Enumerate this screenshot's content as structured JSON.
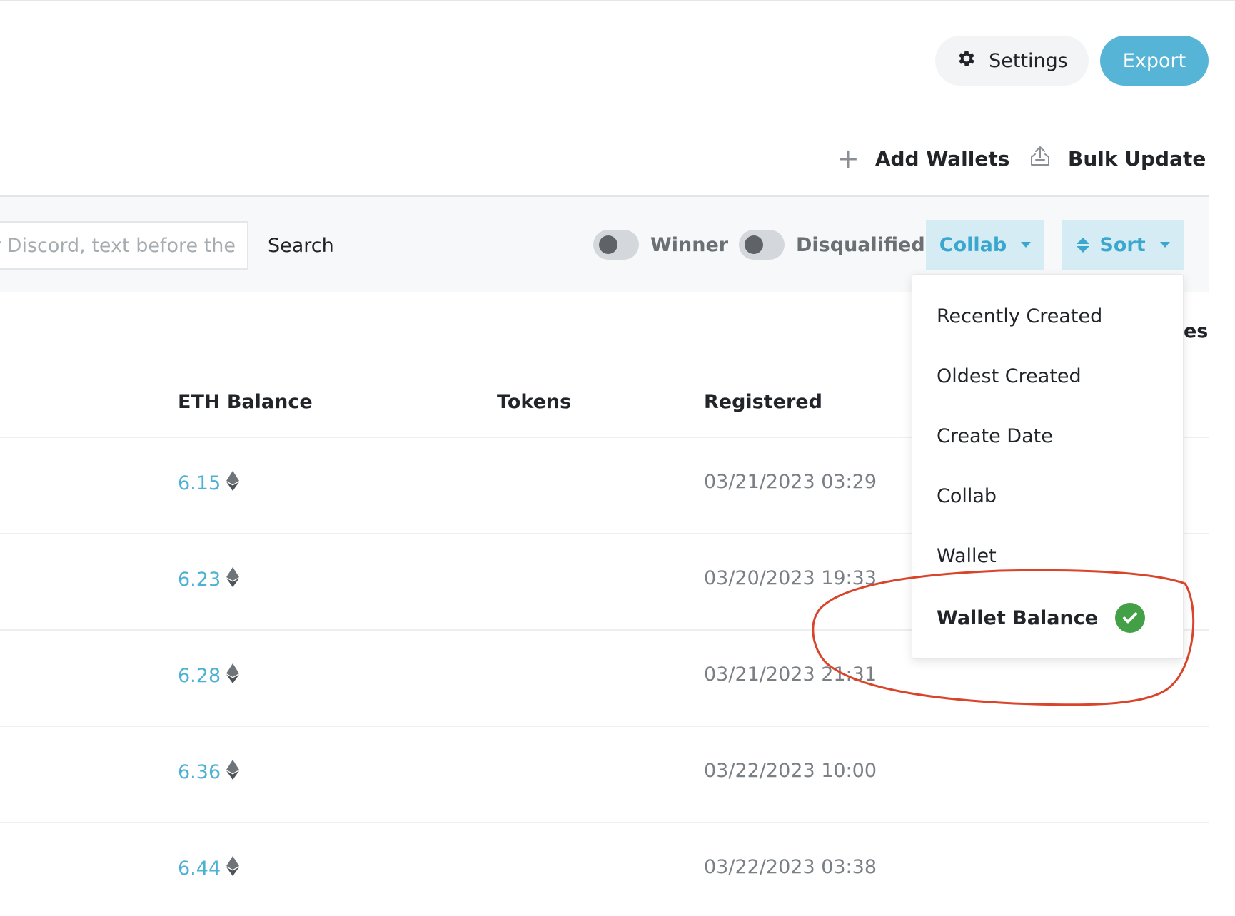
{
  "header": {
    "settings_label": "Settings",
    "export_label": "Export"
  },
  "actions": {
    "add_wallets": "Add Wallets",
    "bulk_update": "Bulk Update"
  },
  "filters": {
    "search_placeholder": "r Discord, text before the #",
    "search_button": "Search",
    "winner_label": "Winner",
    "disqualified_label": "Disqualified",
    "collab_label": "Collab",
    "sort_label": "Sort"
  },
  "table": {
    "partial_header": "es",
    "columns": [
      "ETH Balance",
      "Tokens",
      "Registered"
    ],
    "rows": [
      {
        "eth": "6.15",
        "tokens": "",
        "registered": "03/21/2023 03:29"
      },
      {
        "eth": "6.23",
        "tokens": "",
        "registered": "03/20/2023 19:33"
      },
      {
        "eth": "6.28",
        "tokens": "",
        "registered": "03/21/2023 21:31"
      },
      {
        "eth": "6.36",
        "tokens": "",
        "registered": "03/22/2023 10:00"
      },
      {
        "eth": "6.44",
        "tokens": "",
        "registered": "03/22/2023 03:38"
      }
    ]
  },
  "sort_menu": {
    "items": [
      "Recently Created",
      "Oldest Created",
      "Create Date",
      "Collab",
      "Wallet",
      "Wallet Balance"
    ],
    "selected": "Wallet Balance"
  },
  "colors": {
    "accent": "#56b5d6",
    "link": "#4cb1d3",
    "success": "#43a047",
    "annotation": "#d9442b"
  }
}
